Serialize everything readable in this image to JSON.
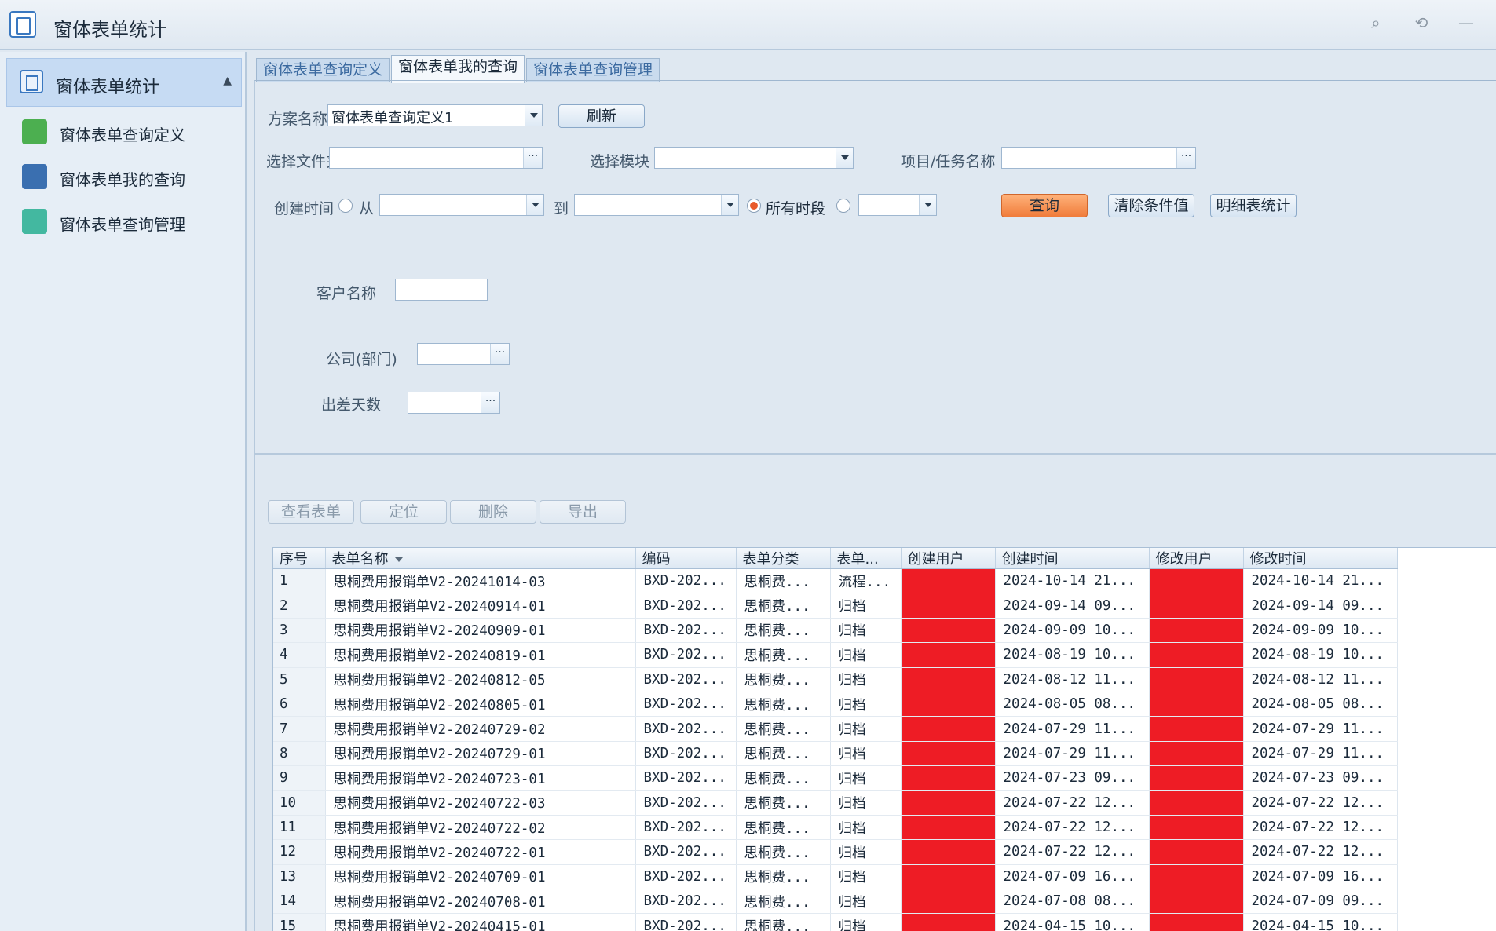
{
  "window": {
    "title": "窗体表单统计"
  },
  "sidebar": {
    "header": "窗体表单统计",
    "items": [
      {
        "label": "窗体表单查询定义",
        "color": "#4caf50"
      },
      {
        "label": "窗体表单我的查询",
        "color": "#3a6fb0"
      },
      {
        "label": "窗体表单查询管理",
        "color": "#43b8a0"
      }
    ]
  },
  "tabs": [
    "窗体表单查询定义",
    "窗体表单我的查询",
    "窗体表单查询管理"
  ],
  "filters": {
    "scheme_label": "方案名称",
    "scheme_value": "窗体表单查询定义1",
    "refresh": "刷新",
    "folder_label": "选择文件夹",
    "module_label": "选择模块",
    "project_label": "项目/任务名称",
    "time_label": "创建时间",
    "from": "从",
    "to": "到",
    "all_time": "所有时段",
    "query": "查询",
    "clear": "清除条件值",
    "detail": "明细表统计",
    "customer_label": "客户名称",
    "company_label": "公司(部门)",
    "days_label": "出差天数"
  },
  "actions": {
    "view": "查看表单",
    "locate": "定位",
    "delete": "删除",
    "export": "导出"
  },
  "table": {
    "columns": [
      "序号",
      "表单名称",
      "编码",
      "表单分类",
      "表单...",
      "创建用户",
      "创建时间",
      "修改用户",
      "修改时间"
    ],
    "rows": [
      [
        "1",
        "思桐费用报销单V2-20241014-03",
        "BXD-202...",
        "思桐费...",
        "流程...",
        "",
        "2024-10-14 21...",
        "",
        "2024-10-14 21..."
      ],
      [
        "2",
        "思桐费用报销单V2-20240914-01",
        "BXD-202...",
        "思桐费...",
        "归档",
        "",
        "2024-09-14 09...",
        "",
        "2024-09-14 09..."
      ],
      [
        "3",
        "思桐费用报销单V2-20240909-01",
        "BXD-202...",
        "思桐费...",
        "归档",
        "",
        "2024-09-09 10...",
        "",
        "2024-09-09 10..."
      ],
      [
        "4",
        "思桐费用报销单V2-20240819-01",
        "BXD-202...",
        "思桐费...",
        "归档",
        "",
        "2024-08-19 10...",
        "",
        "2024-08-19 10..."
      ],
      [
        "5",
        "思桐费用报销单V2-20240812-05",
        "BXD-202...",
        "思桐费...",
        "归档",
        "",
        "2024-08-12 11...",
        "",
        "2024-08-12 11..."
      ],
      [
        "6",
        "思桐费用报销单V2-20240805-01",
        "BXD-202...",
        "思桐费...",
        "归档",
        "",
        "2024-08-05 08...",
        "",
        "2024-08-05 08..."
      ],
      [
        "7",
        "思桐费用报销单V2-20240729-02",
        "BXD-202...",
        "思桐费...",
        "归档",
        "",
        "2024-07-29 11...",
        "",
        "2024-07-29 11..."
      ],
      [
        "8",
        "思桐费用报销单V2-20240729-01",
        "BXD-202...",
        "思桐费...",
        "归档",
        "",
        "2024-07-29 11...",
        "",
        "2024-07-29 11..."
      ],
      [
        "9",
        "思桐费用报销单V2-20240723-01",
        "BXD-202...",
        "思桐费...",
        "归档",
        "",
        "2024-07-23 09...",
        "",
        "2024-07-23 09..."
      ],
      [
        "10",
        "思桐费用报销单V2-20240722-03",
        "BXD-202...",
        "思桐费...",
        "归档",
        "",
        "2024-07-22 12...",
        "",
        "2024-07-22 12..."
      ],
      [
        "11",
        "思桐费用报销单V2-20240722-02",
        "BXD-202...",
        "思桐费...",
        "归档",
        "",
        "2024-07-22 12...",
        "",
        "2024-07-22 12..."
      ],
      [
        "12",
        "思桐费用报销单V2-20240722-01",
        "BXD-202...",
        "思桐费...",
        "归档",
        "",
        "2024-07-22 12...",
        "",
        "2024-07-22 12..."
      ],
      [
        "13",
        "思桐费用报销单V2-20240709-01",
        "BXD-202...",
        "思桐费...",
        "归档",
        "",
        "2024-07-09 16...",
        "",
        "2024-07-09 16..."
      ],
      [
        "14",
        "思桐费用报销单V2-20240708-01",
        "BXD-202...",
        "思桐费...",
        "归档",
        "",
        "2024-07-08 08...",
        "",
        "2024-07-09 09..."
      ],
      [
        "15",
        "思桐费用报销单V2-20240415-01",
        "BXD-202...",
        "思桐费...",
        "归档",
        "",
        "2024-04-15 10...",
        "",
        "2024-04-15 10..."
      ]
    ]
  },
  "redaction_color": "#ee1c25"
}
